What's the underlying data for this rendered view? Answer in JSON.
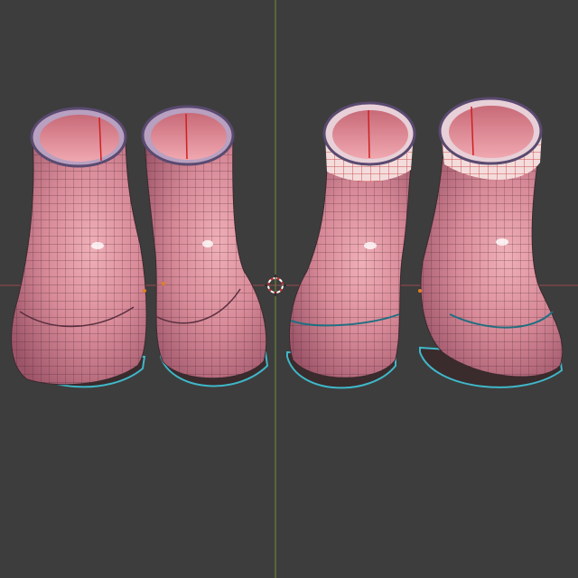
{
  "viewport": {
    "background": "#3d3d3d",
    "axis_x_color": "#9a4650",
    "axis_y_color": "#6f8f3a"
  },
  "boots": {
    "fill_light": "#eaa3ad",
    "fill_dark": "#9c5468",
    "wire_color": "#4a2a34",
    "sole_color": "#3a2b2c",
    "outline_color": "#3fb7c9",
    "seam_color": "#d02020"
  }
}
